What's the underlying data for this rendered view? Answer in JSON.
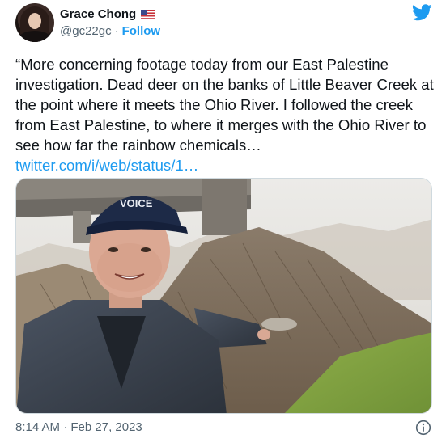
{
  "author": {
    "display_name": "Grace Chong",
    "flag": "🇺🇸",
    "handle": "@gc22gc",
    "separator": "·",
    "follow_label": "Follow"
  },
  "tweet": {
    "text": "“More concerning footage today from our East Palestine investigation. Dead deer on the banks of Little Beaver Creek at the point where it meets the Ohio River. I followed the creek from East Palestine, to where it merges with the Ohio River to see how far the rainbow chemicals… ",
    "link_text": "twitter.com/i/web/status/1…"
  },
  "media": {
    "cap_text": "VOICE"
  },
  "footer": {
    "timestamp": "8:14 AM · Feb 27, 2023"
  },
  "icons": {
    "brand": "twitter-bird-icon",
    "info": "info-icon",
    "flag": "us-flag-icon"
  },
  "colors": {
    "accent": "#1d9bf0",
    "text": "#0f1419",
    "secondary": "#536471",
    "border": "#cfd9de"
  }
}
